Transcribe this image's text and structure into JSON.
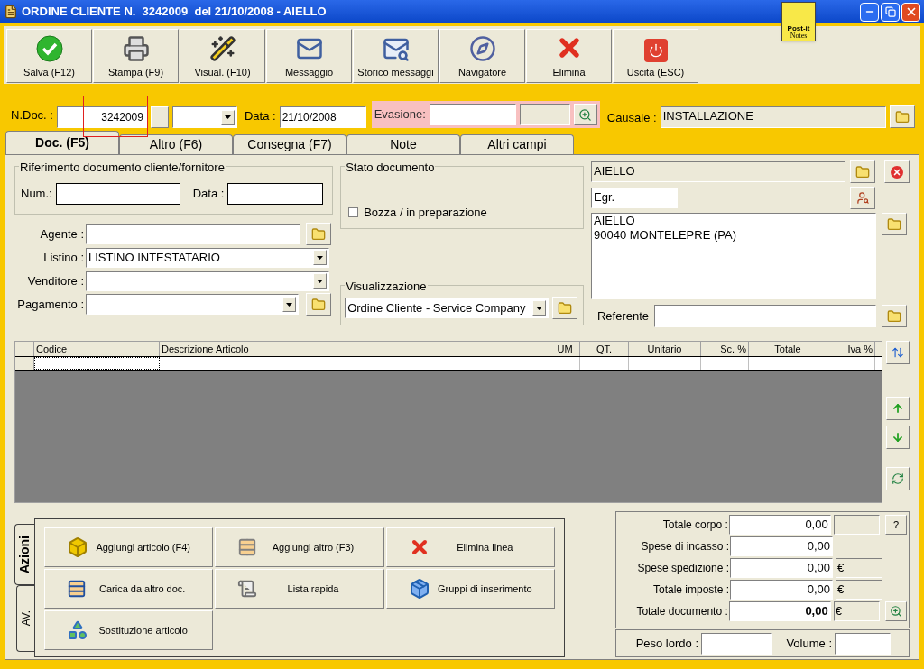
{
  "window": {
    "title": "ORDINE CLIENTE N.  3242009  del 21/10/2008 - AIELLO"
  },
  "post_it": {
    "brand": "Post-it",
    "caption": "Notes"
  },
  "toolbar": [
    {
      "label": "Salva (F12)",
      "kind": "save"
    },
    {
      "label": "Stampa (F9)",
      "kind": "print"
    },
    {
      "label": "Visual. (F10)",
      "kind": "view"
    },
    {
      "label": "Messaggio",
      "kind": "message"
    },
    {
      "label": "Storico messaggi",
      "kind": "history"
    },
    {
      "label": "Navigatore",
      "kind": "navigator"
    },
    {
      "label": "Elimina",
      "kind": "delete"
    },
    {
      "label": "Uscita (ESC)",
      "kind": "exit"
    }
  ],
  "header": {
    "ndoc_label": "N.Doc. :",
    "ndoc_value": "3242009",
    "ndoc_highlighted": true,
    "data_label": "Data :",
    "data_value": "21/10/2008",
    "evasione_label": "Evasione:",
    "causale_label": "Causale :",
    "causale_value": "INSTALLAZIONE"
  },
  "tabs": [
    {
      "label": "Doc. (F5)",
      "selected": true
    },
    {
      "label": "Altro (F6)",
      "selected": false
    },
    {
      "label": "Consegna (F7)",
      "selected": false
    },
    {
      "label": "Note",
      "selected": false
    },
    {
      "label": "Altri campi",
      "selected": false
    }
  ],
  "riferimento": {
    "title": "Riferimento documento cliente/fornitore",
    "num_label": "Num.:",
    "data_label": "Data :"
  },
  "fields": [
    {
      "label": "Agente :",
      "kind": "lookup"
    },
    {
      "label": "Listino :",
      "value": "LISTINO INTESTATARIO",
      "kind": "select"
    },
    {
      "label": "Venditore :",
      "kind": "select"
    },
    {
      "label": "Pagamento :",
      "kind": "select_lookup"
    }
  ],
  "stato": {
    "title": "Stato documento",
    "checkbox_label": "Bozza / in preparazione",
    "checked": false
  },
  "visualizzazione": {
    "title": "Visualizzazione",
    "value": "Ordine Cliente - Service Company"
  },
  "customer": {
    "name": "AIELLO",
    "salutation": "Egr.",
    "address": [
      "AIELLO",
      "90040 MONTELEPRE (PA)"
    ],
    "referente_label": "Referente"
  },
  "table": {
    "columns": [
      {
        "label": "Codice"
      },
      {
        "label": "Descrizione Articolo"
      },
      {
        "label": "UM"
      },
      {
        "label": "QT."
      },
      {
        "label": "Unitario"
      },
      {
        "label": "Sc. %"
      },
      {
        "label": "Totale"
      },
      {
        "label": "Iva %"
      }
    ]
  },
  "side_tabs": [
    {
      "label": "Azioni",
      "selected": true
    },
    {
      "label": "AV.",
      "selected": false
    }
  ],
  "actions": [
    {
      "label": "Aggiungi articolo (F4)",
      "kind": "add-item"
    },
    {
      "label": "Aggiungi altro (F3)",
      "kind": "add-other"
    },
    {
      "label": "Elimina linea",
      "kind": "delete"
    },
    {
      "label": "Carica da altro doc.",
      "kind": "load"
    },
    {
      "label": "Lista rapida",
      "kind": "quick-list"
    },
    {
      "label": "Gruppi di inserimento",
      "kind": "groups"
    },
    {
      "label": "Sostituzione articolo",
      "kind": "replace"
    }
  ],
  "totals": [
    {
      "label": "Totale corpo :",
      "value": "0,00",
      "bold": false,
      "suffix_box": true,
      "help_button": "?"
    },
    {
      "label": "Spese di incasso :",
      "value": "0,00",
      "bold": false,
      "suffix_box": false
    },
    {
      "label": "Spese spedizione :",
      "value": "0,00",
      "bold": false,
      "suffix_box": true,
      "currency": "€"
    },
    {
      "label": "Totale imposte :",
      "value": "0,00",
      "bold": false,
      "suffix_box": true,
      "currency": "€"
    },
    {
      "label": "Totale documento :",
      "value": "0,00",
      "bold": true,
      "suffix_box": true,
      "currency": "€",
      "zoom_button": true
    }
  ],
  "weights": {
    "peso_label": "Peso lordo :",
    "volume_label": "Volume :"
  }
}
